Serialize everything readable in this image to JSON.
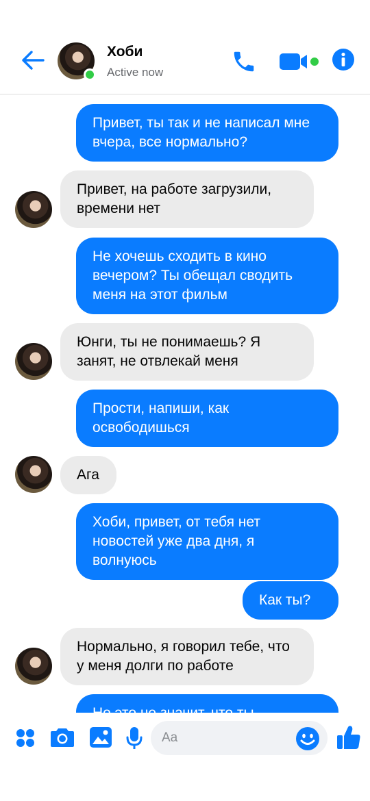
{
  "header": {
    "contact_name": "Хоби",
    "status": "Active now",
    "icons": [
      "back-arrow-icon",
      "phone-icon",
      "video-camera-icon",
      "info-icon"
    ],
    "online": true
  },
  "messages": [
    {
      "sender": "me",
      "text": "Привет, ты так и не написал мне вчера, все нормально?"
    },
    {
      "sender": "contact",
      "text": "Привет, на работе загрузили, времени нет"
    },
    {
      "sender": "me",
      "text": "Не хочешь сходить в кино вечером? Ты обещал сводить меня на этот фильм"
    },
    {
      "sender": "contact",
      "text": "Юнги, ты не понимаешь? Я занят, не отвлекай меня"
    },
    {
      "sender": "me",
      "text": "Прости, напиши, как освободишься"
    },
    {
      "sender": "contact",
      "text": "Ага"
    },
    {
      "sender": "me",
      "text": "Хоби, привет, от тебя нет новостей уже два дня, я волнуюсь"
    },
    {
      "sender": "me",
      "text": "Как ты?"
    },
    {
      "sender": "contact",
      "text": "Нормально, я говорил тебе, что у меня долги по работе"
    },
    {
      "sender": "me",
      "text": "Но это не значит, что ты"
    }
  ],
  "composer": {
    "placeholder": "Aa",
    "value": "",
    "icons": [
      "apps-grid-icon",
      "camera-icon",
      "gallery-icon",
      "microphone-icon",
      "emoji-icon",
      "thumbs-up-icon"
    ]
  },
  "colors": {
    "accent": "#0a7cff",
    "incoming_bubble": "#ebebeb",
    "online": "#31cc46"
  }
}
